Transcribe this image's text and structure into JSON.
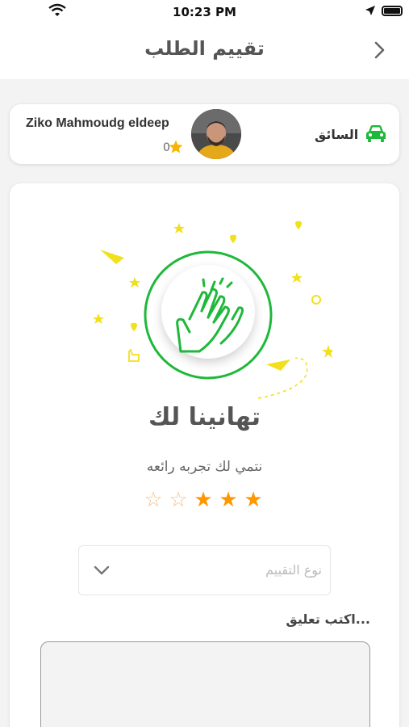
{
  "status_bar": {
    "time": "10:23 PM"
  },
  "nav": {
    "title": "تقييم الطلب"
  },
  "driver": {
    "name": "Ziko Mahmoudg eldeep",
    "rating": "0",
    "role_label": "السائق"
  },
  "main": {
    "congrats": "تهانينا لك",
    "subtitle": "نتمي لك تجربه رائعه",
    "rating_value": 3,
    "rating_max": 5,
    "rating_type_placeholder": "نوع التقييم",
    "comment_label": "اكتب تعليق..."
  },
  "colors": {
    "green": "#1eb83a",
    "yellow": "#f2e01c",
    "star_on": "#ff9800",
    "star_off": "#f7c08a"
  },
  "icons": {
    "back": "chevron-right-icon",
    "car": "car-icon",
    "clap": "clapping-hands-icon",
    "dropdown": "chevron-down-icon"
  }
}
